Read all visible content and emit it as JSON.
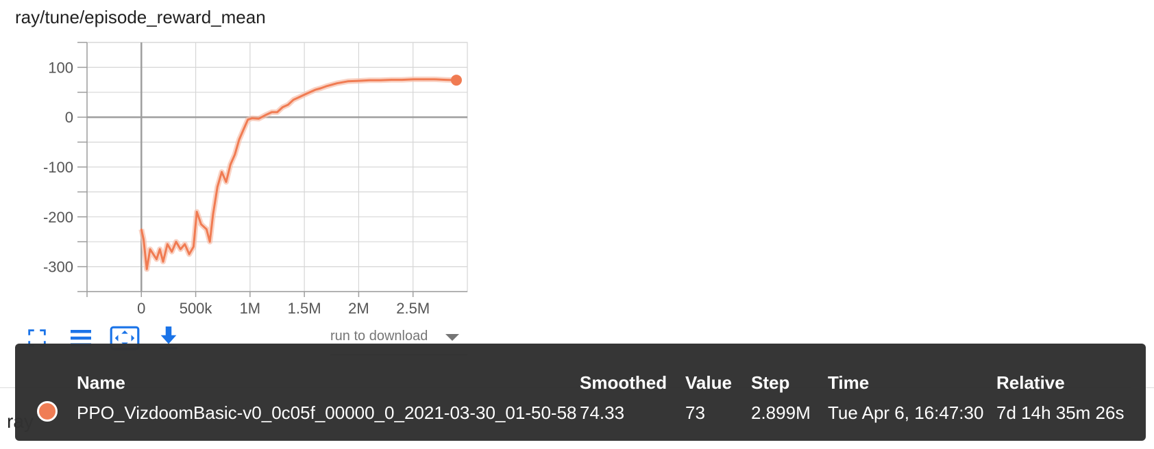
{
  "colors": {
    "series": "#f07b52",
    "series_raw": "#f7c1ad",
    "tooltip_bg": "#323232",
    "toolbar_icon": "#1a73e8"
  },
  "chart_data": {
    "type": "line",
    "title": "ray/tune/episode_reward_mean",
    "xlim": [
      -500000,
      3000000
    ],
    "ylim": [
      -350,
      150
    ],
    "x_ticks": [
      0,
      500000,
      1000000,
      1500000,
      2000000,
      2500000
    ],
    "x_tick_labels": [
      "0",
      "500k",
      "1M",
      "1.5M",
      "2M",
      "2.5M"
    ],
    "y_ticks": [
      100,
      0,
      -100,
      -200,
      -300
    ],
    "y_tick_labels": [
      "100",
      "0",
      "-100",
      "-200",
      "-300"
    ],
    "grid": true,
    "series": [
      {
        "name": "PPO_VizdoomBasic-v0_0c05f_00000_0_2021-03-30_01-50-58",
        "x": [
          0,
          20000,
          50000,
          80000,
          110000,
          140000,
          170000,
          200000,
          240000,
          280000,
          320000,
          360000,
          400000,
          440000,
          480000,
          510000,
          550000,
          600000,
          630000,
          660000,
          700000,
          740000,
          780000,
          820000,
          860000,
          900000,
          940000,
          980000,
          1020000,
          1080000,
          1150000,
          1200000,
          1250000,
          1300000,
          1350000,
          1400000,
          1450000,
          1500000,
          1550000,
          1600000,
          1650000,
          1700000,
          1800000,
          1900000,
          2000000,
          2100000,
          2200000,
          2300000,
          2400000,
          2500000,
          2600000,
          2700000,
          2800000,
          2899000
        ],
        "y": [
          -225,
          -245,
          -305,
          -265,
          -275,
          -285,
          -265,
          -290,
          -255,
          -270,
          -250,
          -265,
          -255,
          -275,
          -260,
          -190,
          -215,
          -225,
          -250,
          -195,
          -140,
          -110,
          -130,
          -95,
          -75,
          -45,
          -25,
          -5,
          -2,
          -3,
          5,
          10,
          10,
          20,
          25,
          35,
          40,
          45,
          50,
          55,
          58,
          62,
          68,
          72,
          73,
          74,
          74,
          75,
          75,
          76,
          76,
          76,
          75,
          74.33
        ]
      }
    ]
  },
  "toolbar": {
    "fullscreen_icon": "fullscreen-icon",
    "legend_icon": "list-icon",
    "fit_icon": "fit-domain-icon",
    "download_icon": "download-icon",
    "run_dropdown_label": "run to download"
  },
  "background_text": "ray",
  "tooltip": {
    "headers": [
      "Name",
      "Smoothed",
      "Value",
      "Step",
      "Time",
      "Relative"
    ],
    "row": {
      "name": "PPO_VizdoomBasic-v0_0c05f_00000_0_2021-03-30_01-50-58",
      "smoothed": "74.33",
      "value": "73",
      "step": "2.899M",
      "time": "Tue Apr 6, 16:47:30",
      "relative": "7d 14h 35m 26s"
    }
  }
}
